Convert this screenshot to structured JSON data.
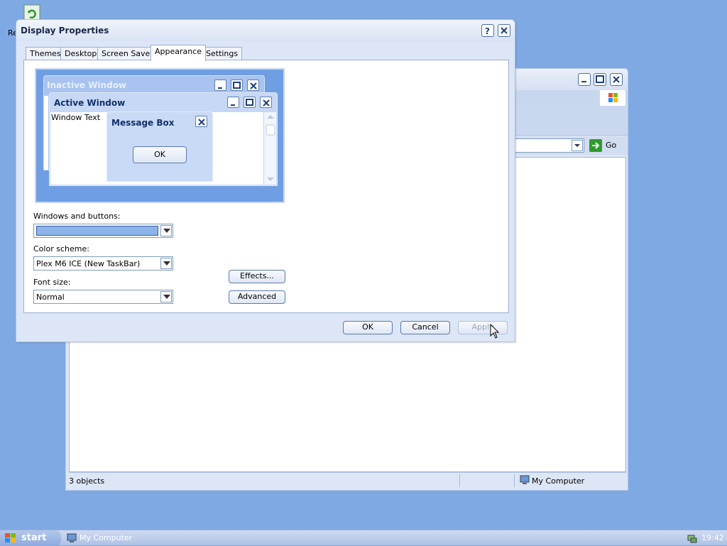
{
  "desktop": {
    "icon_label": "Re"
  },
  "background_window": {
    "address_go_label": "Go",
    "status_objects": "3 objects",
    "status_location": "My Computer"
  },
  "dialog": {
    "title": "Display Properties",
    "tabs": [
      {
        "label": "Themes"
      },
      {
        "label": "Desktop"
      },
      {
        "label": "Screen Saver"
      },
      {
        "label": "Appearance",
        "active": true
      },
      {
        "label": "Settings"
      }
    ],
    "preview": {
      "inactive_window_title": "Inactive Window",
      "active_window_title": "Active Window",
      "window_text": "Window Text",
      "message_box_title": "Message Box",
      "message_box_ok": "OK"
    },
    "windows_buttons": {
      "label": "Windows and buttons:",
      "value": ""
    },
    "color_scheme": {
      "label": "Color scheme:",
      "value": "Plex M6 ICE (New TaskBar)"
    },
    "font_size": {
      "label": "Font size:",
      "value": "Normal"
    },
    "effects_button": "Effects...",
    "advanced_button": "Advanced",
    "ok_button": "OK",
    "cancel_button": "Cancel",
    "apply_button": "Apply"
  },
  "taskbar": {
    "start_label": "start",
    "task_label": "My Computer",
    "clock": "19:42"
  },
  "colors": {
    "desktop_background": "#7FA9E2",
    "selected_windows_buttons_swatch": "#8db4ea"
  }
}
